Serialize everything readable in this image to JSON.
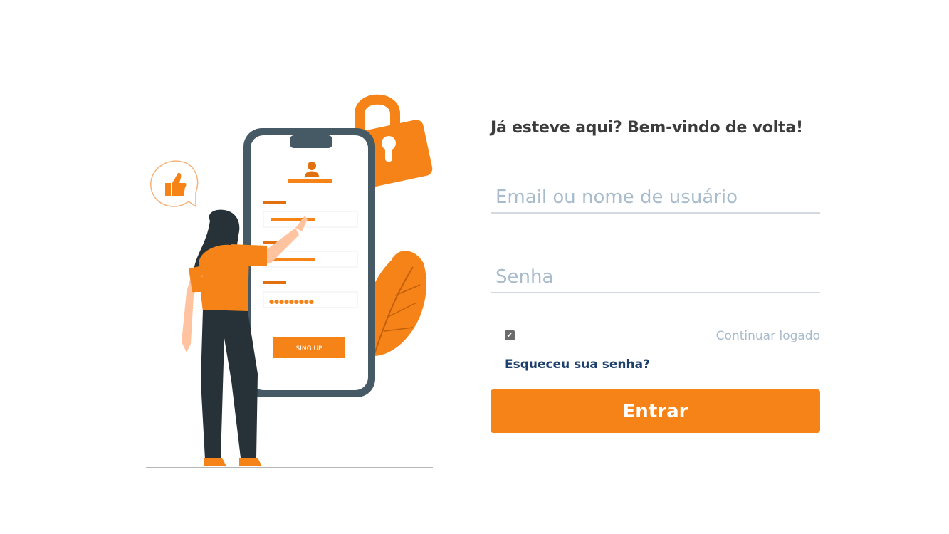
{
  "login": {
    "heading": "Já esteve aqui? Bem-vindo de volta!",
    "email_placeholder": "Email ou nome de usuário",
    "password_placeholder": "Senha",
    "remember_label": "Continuar logado",
    "remember_checked": true,
    "forgot_label": "Esqueceu sua senha?",
    "submit_label": "Entrar"
  },
  "illustration": {
    "phone_button_label": "SING UP",
    "password_dots": "●●●●●●●●●"
  },
  "colors": {
    "accent": "#f58318",
    "heading": "#3c3c3c",
    "placeholder": "#a9bccd",
    "link": "#1c3f6b",
    "phone_frame": "#455a64",
    "figure_dark": "#263238"
  },
  "icons": [
    "lock-icon",
    "user-icon",
    "thumbs-up-icon",
    "leaf-icon",
    "check-icon"
  ]
}
